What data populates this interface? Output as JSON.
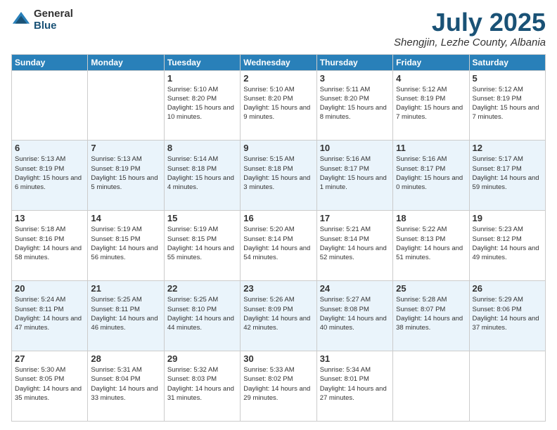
{
  "logo": {
    "general": "General",
    "blue": "Blue"
  },
  "title": "July 2025",
  "location": "Shengjin, Lezhe County, Albania",
  "days_of_week": [
    "Sunday",
    "Monday",
    "Tuesday",
    "Wednesday",
    "Thursday",
    "Friday",
    "Saturday"
  ],
  "weeks": [
    [
      {
        "day": "",
        "sunrise": "",
        "sunset": "",
        "daylight": ""
      },
      {
        "day": "",
        "sunrise": "",
        "sunset": "",
        "daylight": ""
      },
      {
        "day": "1",
        "sunrise": "Sunrise: 5:10 AM",
        "sunset": "Sunset: 8:20 PM",
        "daylight": "Daylight: 15 hours and 10 minutes."
      },
      {
        "day": "2",
        "sunrise": "Sunrise: 5:10 AM",
        "sunset": "Sunset: 8:20 PM",
        "daylight": "Daylight: 15 hours and 9 minutes."
      },
      {
        "day": "3",
        "sunrise": "Sunrise: 5:11 AM",
        "sunset": "Sunset: 8:20 PM",
        "daylight": "Daylight: 15 hours and 8 minutes."
      },
      {
        "day": "4",
        "sunrise": "Sunrise: 5:12 AM",
        "sunset": "Sunset: 8:19 PM",
        "daylight": "Daylight: 15 hours and 7 minutes."
      },
      {
        "day": "5",
        "sunrise": "Sunrise: 5:12 AM",
        "sunset": "Sunset: 8:19 PM",
        "daylight": "Daylight: 15 hours and 7 minutes."
      }
    ],
    [
      {
        "day": "6",
        "sunrise": "Sunrise: 5:13 AM",
        "sunset": "Sunset: 8:19 PM",
        "daylight": "Daylight: 15 hours and 6 minutes."
      },
      {
        "day": "7",
        "sunrise": "Sunrise: 5:13 AM",
        "sunset": "Sunset: 8:19 PM",
        "daylight": "Daylight: 15 hours and 5 minutes."
      },
      {
        "day": "8",
        "sunrise": "Sunrise: 5:14 AM",
        "sunset": "Sunset: 8:18 PM",
        "daylight": "Daylight: 15 hours and 4 minutes."
      },
      {
        "day": "9",
        "sunrise": "Sunrise: 5:15 AM",
        "sunset": "Sunset: 8:18 PM",
        "daylight": "Daylight: 15 hours and 3 minutes."
      },
      {
        "day": "10",
        "sunrise": "Sunrise: 5:16 AM",
        "sunset": "Sunset: 8:17 PM",
        "daylight": "Daylight: 15 hours and 1 minute."
      },
      {
        "day": "11",
        "sunrise": "Sunrise: 5:16 AM",
        "sunset": "Sunset: 8:17 PM",
        "daylight": "Daylight: 15 hours and 0 minutes."
      },
      {
        "day": "12",
        "sunrise": "Sunrise: 5:17 AM",
        "sunset": "Sunset: 8:17 PM",
        "daylight": "Daylight: 14 hours and 59 minutes."
      }
    ],
    [
      {
        "day": "13",
        "sunrise": "Sunrise: 5:18 AM",
        "sunset": "Sunset: 8:16 PM",
        "daylight": "Daylight: 14 hours and 58 minutes."
      },
      {
        "day": "14",
        "sunrise": "Sunrise: 5:19 AM",
        "sunset": "Sunset: 8:15 PM",
        "daylight": "Daylight: 14 hours and 56 minutes."
      },
      {
        "day": "15",
        "sunrise": "Sunrise: 5:19 AM",
        "sunset": "Sunset: 8:15 PM",
        "daylight": "Daylight: 14 hours and 55 minutes."
      },
      {
        "day": "16",
        "sunrise": "Sunrise: 5:20 AM",
        "sunset": "Sunset: 8:14 PM",
        "daylight": "Daylight: 14 hours and 54 minutes."
      },
      {
        "day": "17",
        "sunrise": "Sunrise: 5:21 AM",
        "sunset": "Sunset: 8:14 PM",
        "daylight": "Daylight: 14 hours and 52 minutes."
      },
      {
        "day": "18",
        "sunrise": "Sunrise: 5:22 AM",
        "sunset": "Sunset: 8:13 PM",
        "daylight": "Daylight: 14 hours and 51 minutes."
      },
      {
        "day": "19",
        "sunrise": "Sunrise: 5:23 AM",
        "sunset": "Sunset: 8:12 PM",
        "daylight": "Daylight: 14 hours and 49 minutes."
      }
    ],
    [
      {
        "day": "20",
        "sunrise": "Sunrise: 5:24 AM",
        "sunset": "Sunset: 8:11 PM",
        "daylight": "Daylight: 14 hours and 47 minutes."
      },
      {
        "day": "21",
        "sunrise": "Sunrise: 5:25 AM",
        "sunset": "Sunset: 8:11 PM",
        "daylight": "Daylight: 14 hours and 46 minutes."
      },
      {
        "day": "22",
        "sunrise": "Sunrise: 5:25 AM",
        "sunset": "Sunset: 8:10 PM",
        "daylight": "Daylight: 14 hours and 44 minutes."
      },
      {
        "day": "23",
        "sunrise": "Sunrise: 5:26 AM",
        "sunset": "Sunset: 8:09 PM",
        "daylight": "Daylight: 14 hours and 42 minutes."
      },
      {
        "day": "24",
        "sunrise": "Sunrise: 5:27 AM",
        "sunset": "Sunset: 8:08 PM",
        "daylight": "Daylight: 14 hours and 40 minutes."
      },
      {
        "day": "25",
        "sunrise": "Sunrise: 5:28 AM",
        "sunset": "Sunset: 8:07 PM",
        "daylight": "Daylight: 14 hours and 38 minutes."
      },
      {
        "day": "26",
        "sunrise": "Sunrise: 5:29 AM",
        "sunset": "Sunset: 8:06 PM",
        "daylight": "Daylight: 14 hours and 37 minutes."
      }
    ],
    [
      {
        "day": "27",
        "sunrise": "Sunrise: 5:30 AM",
        "sunset": "Sunset: 8:05 PM",
        "daylight": "Daylight: 14 hours and 35 minutes."
      },
      {
        "day": "28",
        "sunrise": "Sunrise: 5:31 AM",
        "sunset": "Sunset: 8:04 PM",
        "daylight": "Daylight: 14 hours and 33 minutes."
      },
      {
        "day": "29",
        "sunrise": "Sunrise: 5:32 AM",
        "sunset": "Sunset: 8:03 PM",
        "daylight": "Daylight: 14 hours and 31 minutes."
      },
      {
        "day": "30",
        "sunrise": "Sunrise: 5:33 AM",
        "sunset": "Sunset: 8:02 PM",
        "daylight": "Daylight: 14 hours and 29 minutes."
      },
      {
        "day": "31",
        "sunrise": "Sunrise: 5:34 AM",
        "sunset": "Sunset: 8:01 PM",
        "daylight": "Daylight: 14 hours and 27 minutes."
      },
      {
        "day": "",
        "sunrise": "",
        "sunset": "",
        "daylight": ""
      },
      {
        "day": "",
        "sunrise": "",
        "sunset": "",
        "daylight": ""
      }
    ]
  ]
}
